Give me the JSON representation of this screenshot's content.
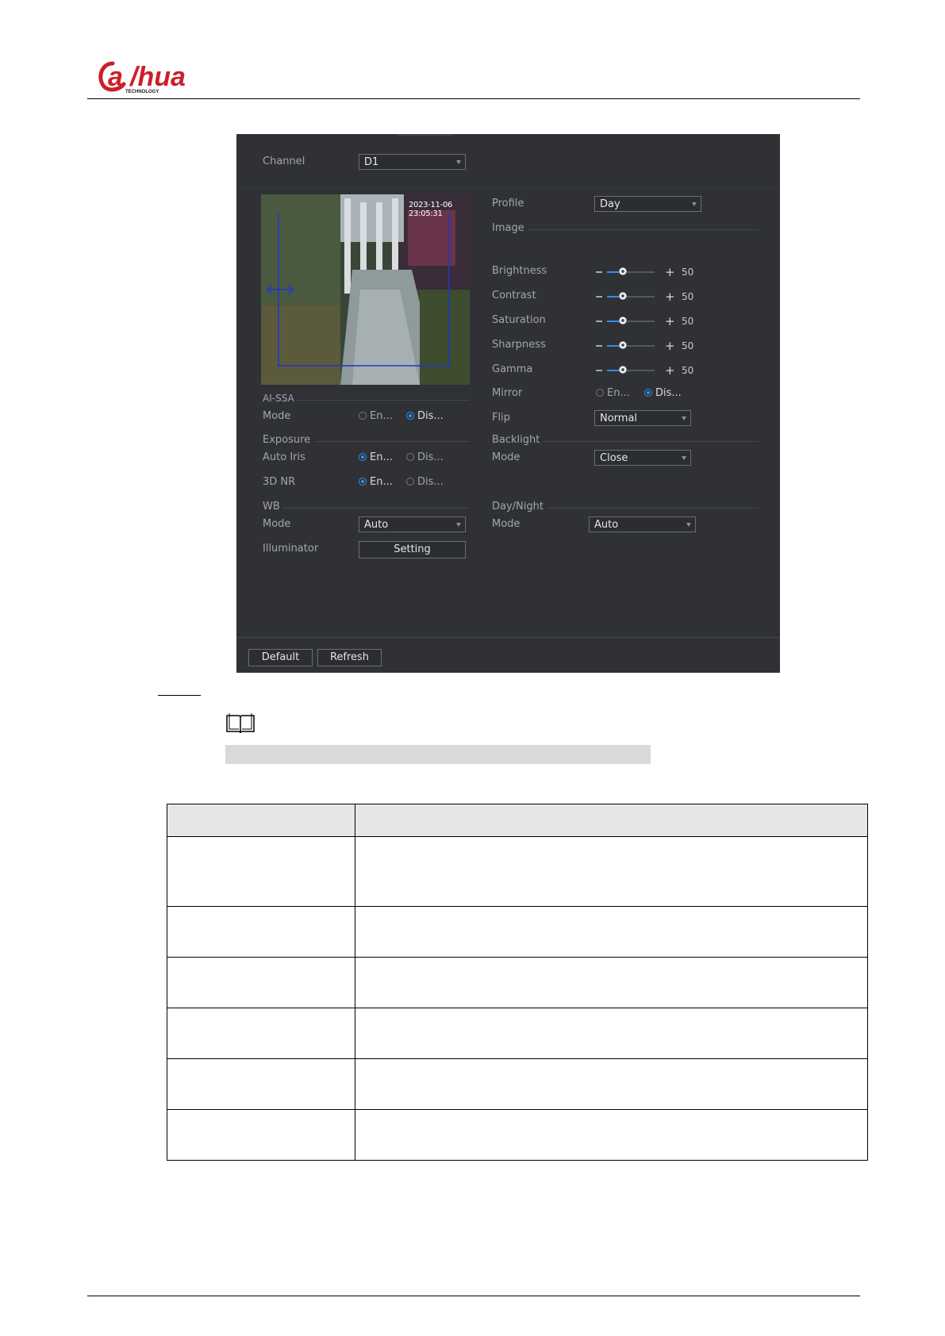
{
  "header": {
    "brand": "alhua",
    "brand_tagline": "TECHNOLOGY",
    "brand_color": "#cc1f2a"
  },
  "panel": {
    "channel": {
      "label": "Channel",
      "value": "D1"
    },
    "preview": {
      "timestamp": "2023-11-06 23:05:31"
    },
    "ai_ssa": {
      "section": "AI-SSA",
      "mode_label": "Mode",
      "enable_label": "En...",
      "disable_label": "Dis...",
      "selected": "disable"
    },
    "exposure": {
      "section": "Exposure",
      "auto_iris_label": "Auto Iris",
      "enable_label": "En...",
      "disable_label": "Dis...",
      "selected": "enable"
    },
    "nr3d": {
      "label": "3D NR",
      "enable_label": "En...",
      "disable_label": "Dis...",
      "selected": "enable"
    },
    "wb": {
      "section": "WB",
      "mode_label": "Mode",
      "mode_value": "Auto"
    },
    "illuminator": {
      "label": "Illuminator",
      "button": "Setting"
    },
    "profile": {
      "label": "Profile",
      "value": "Day"
    },
    "image": {
      "section": "Image",
      "sliders": [
        {
          "label": "Brightness",
          "value": 50,
          "max": 100
        },
        {
          "label": "Contrast",
          "value": 50,
          "max": 100
        },
        {
          "label": "Saturation",
          "value": 50,
          "max": 100
        },
        {
          "label": "Sharpness",
          "value": 50,
          "max": 100
        },
        {
          "label": "Gamma",
          "value": 50,
          "max": 100
        }
      ]
    },
    "mirror": {
      "label": "Mirror",
      "enable_label": "En...",
      "disable_label": "Dis...",
      "selected": "disable"
    },
    "flip": {
      "label": "Flip",
      "value": "Normal"
    },
    "backlight": {
      "section": "Backlight",
      "mode_label": "Mode",
      "mode_value": "Close"
    },
    "day_night": {
      "section": "Day/Night",
      "mode_label": "Mode",
      "mode_value": "Auto"
    },
    "buttons": {
      "default": "Default",
      "refresh": "Refresh"
    },
    "accent_color": "#2f8ff0"
  },
  "table": {
    "header": [
      "",
      ""
    ],
    "rows": [
      [
        "",
        ""
      ],
      [
        "",
        ""
      ],
      [
        "",
        ""
      ],
      [
        "",
        ""
      ],
      [
        "",
        ""
      ],
      [
        "",
        ""
      ]
    ]
  }
}
